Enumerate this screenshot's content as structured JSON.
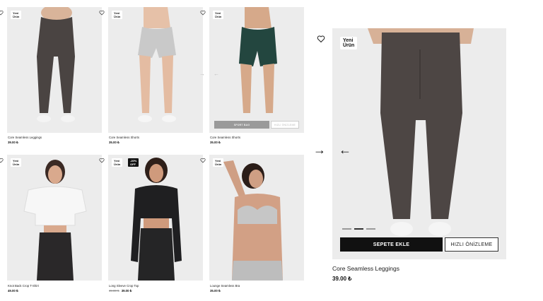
{
  "products": [
    {
      "name": "Core Seamless Leggings",
      "price": "39.00 ₺",
      "badge": "Yeni Ürün"
    },
    {
      "name": "Core Seamless Shorts",
      "price": "35.00 ₺",
      "badge": "Yeni Ürün"
    },
    {
      "name": "Core Seamless Shorts",
      "price": "35.00 ₺",
      "badge": "Yeni Ürün",
      "sold_out_label": "SPORT BAG",
      "quick_label": "HIZLI ÖNİZLEME"
    },
    {
      "name": "Knot Back Crop T-Shirt",
      "price": "49.00 ₺",
      "badge": "Yeni Ürün"
    },
    {
      "name": "Long Sleeve Crop Top",
      "old_price": "49.00 ₺",
      "price": "39.00 ₺",
      "badge": "Yeni Ürün",
      "discount": "-20% OFF"
    },
    {
      "name": "Lounge Seamless Bra",
      "price": "35.00 ₺",
      "badge": "Yeni Ürün"
    }
  ],
  "featured": {
    "badge": "Yeni Ürün",
    "name": "Core Seamless Leggings",
    "price": "39.00 ₺",
    "add_to_cart": "SEPETE EKLE",
    "quick_view": "HIZLI ÖNİZLEME",
    "prev_arrow": "←",
    "next_arrow": "→",
    "image_count": 3,
    "active_image": 2
  },
  "icons": {
    "favorite": "heart-icon",
    "prev": "arrow-left-icon",
    "next": "arrow-right-icon"
  },
  "colors": {
    "button_dark": "#111111",
    "card_bg": "#ececec"
  }
}
